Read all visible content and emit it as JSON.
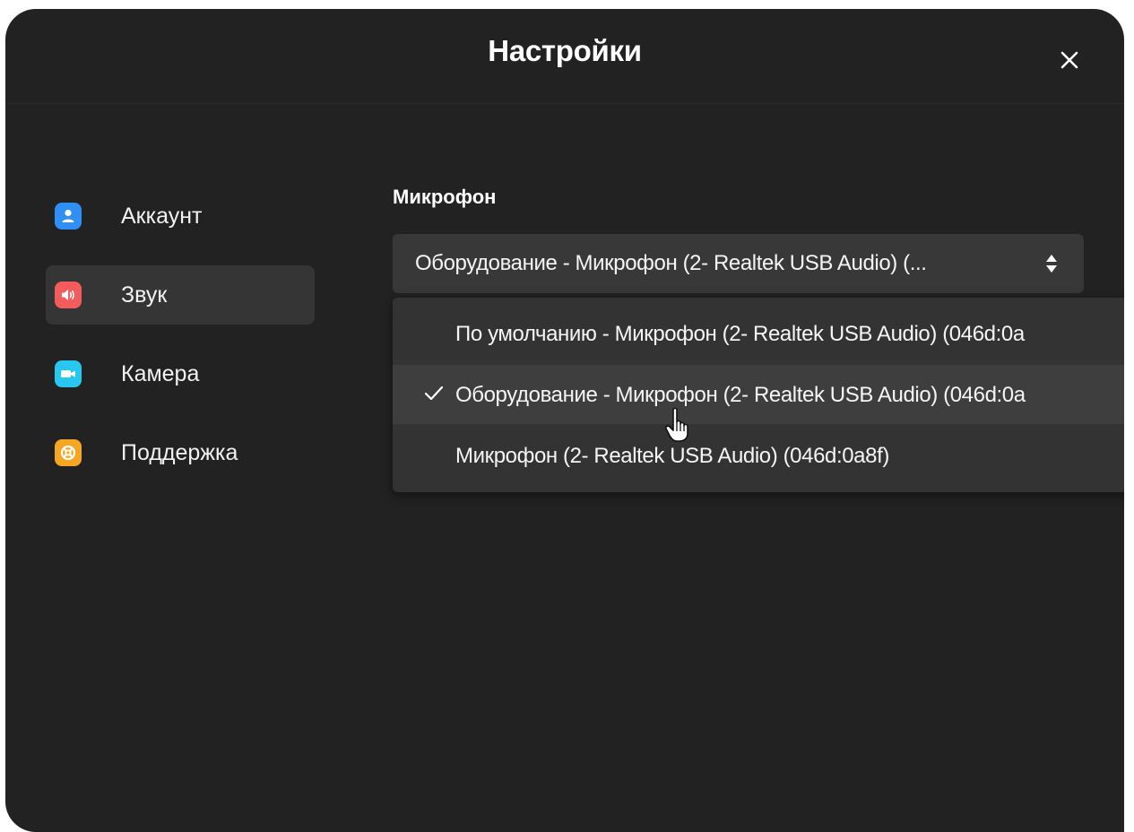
{
  "dialog": {
    "title": "Настройки",
    "close_icon": "close-icon"
  },
  "sidebar": {
    "items": [
      {
        "label": "Аккаунт",
        "icon": "user-icon",
        "color": "#2f8ff5",
        "active": false
      },
      {
        "label": "Звук",
        "icon": "speaker-icon",
        "color": "#f25c5c",
        "active": true
      },
      {
        "label": "Камера",
        "icon": "camera-icon",
        "color": "#27c7ef",
        "active": false
      },
      {
        "label": "Поддержка",
        "icon": "lifebuoy-icon",
        "color": "#f5a623",
        "active": false
      }
    ]
  },
  "microphone": {
    "label": "Микрофон",
    "selected": "Оборудование - Микрофон (2- Realtek USB Audio) (...",
    "options": [
      {
        "label": "По умолчанию - Микрофон (2- Realtek USB Audio) (046d:0a",
        "checked": false
      },
      {
        "label": "Оборудование - Микрофон (2- Realtek USB Audio) (046d:0a",
        "checked": true
      },
      {
        "label": "Микрофон (2- Realtek USB Audio) (046d:0a8f)",
        "checked": false
      }
    ]
  },
  "colors": {
    "dialog_bg": "#222222",
    "select_bg": "#383838",
    "dropdown_bg": "#333333",
    "active_nav_bg": "#353535"
  }
}
